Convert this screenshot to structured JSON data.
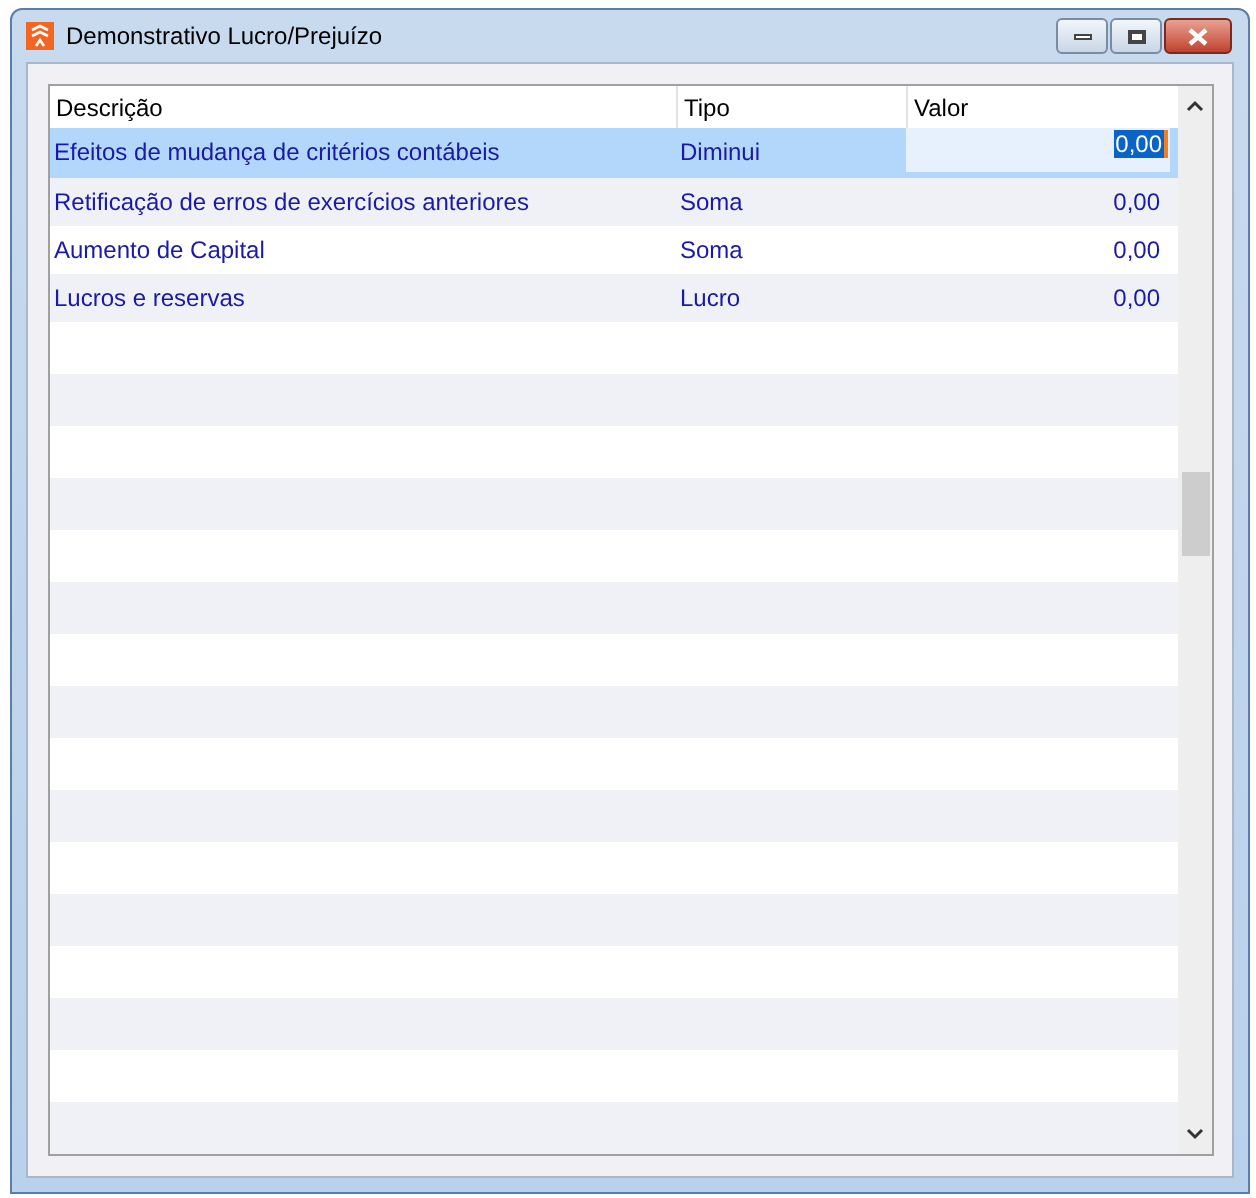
{
  "window": {
    "title": "Demonstrativo Lucro/Prejuízo"
  },
  "table": {
    "columns": [
      "Descrição",
      "Tipo",
      "Valor"
    ],
    "rows": [
      {
        "descricao": "Efeitos de mudança de critérios contábeis",
        "tipo": "Diminui",
        "valor": "0,00",
        "selected": true
      },
      {
        "descricao": "Retificação de erros de exercícios anteriores",
        "tipo": "Soma",
        "valor": "0,00",
        "selected": false
      },
      {
        "descricao": "Aumento de Capital",
        "tipo": "Soma",
        "valor": "0,00",
        "selected": false
      },
      {
        "descricao": "Lucros e reservas",
        "tipo": "Lucro",
        "valor": "0,00",
        "selected": false
      }
    ]
  }
}
